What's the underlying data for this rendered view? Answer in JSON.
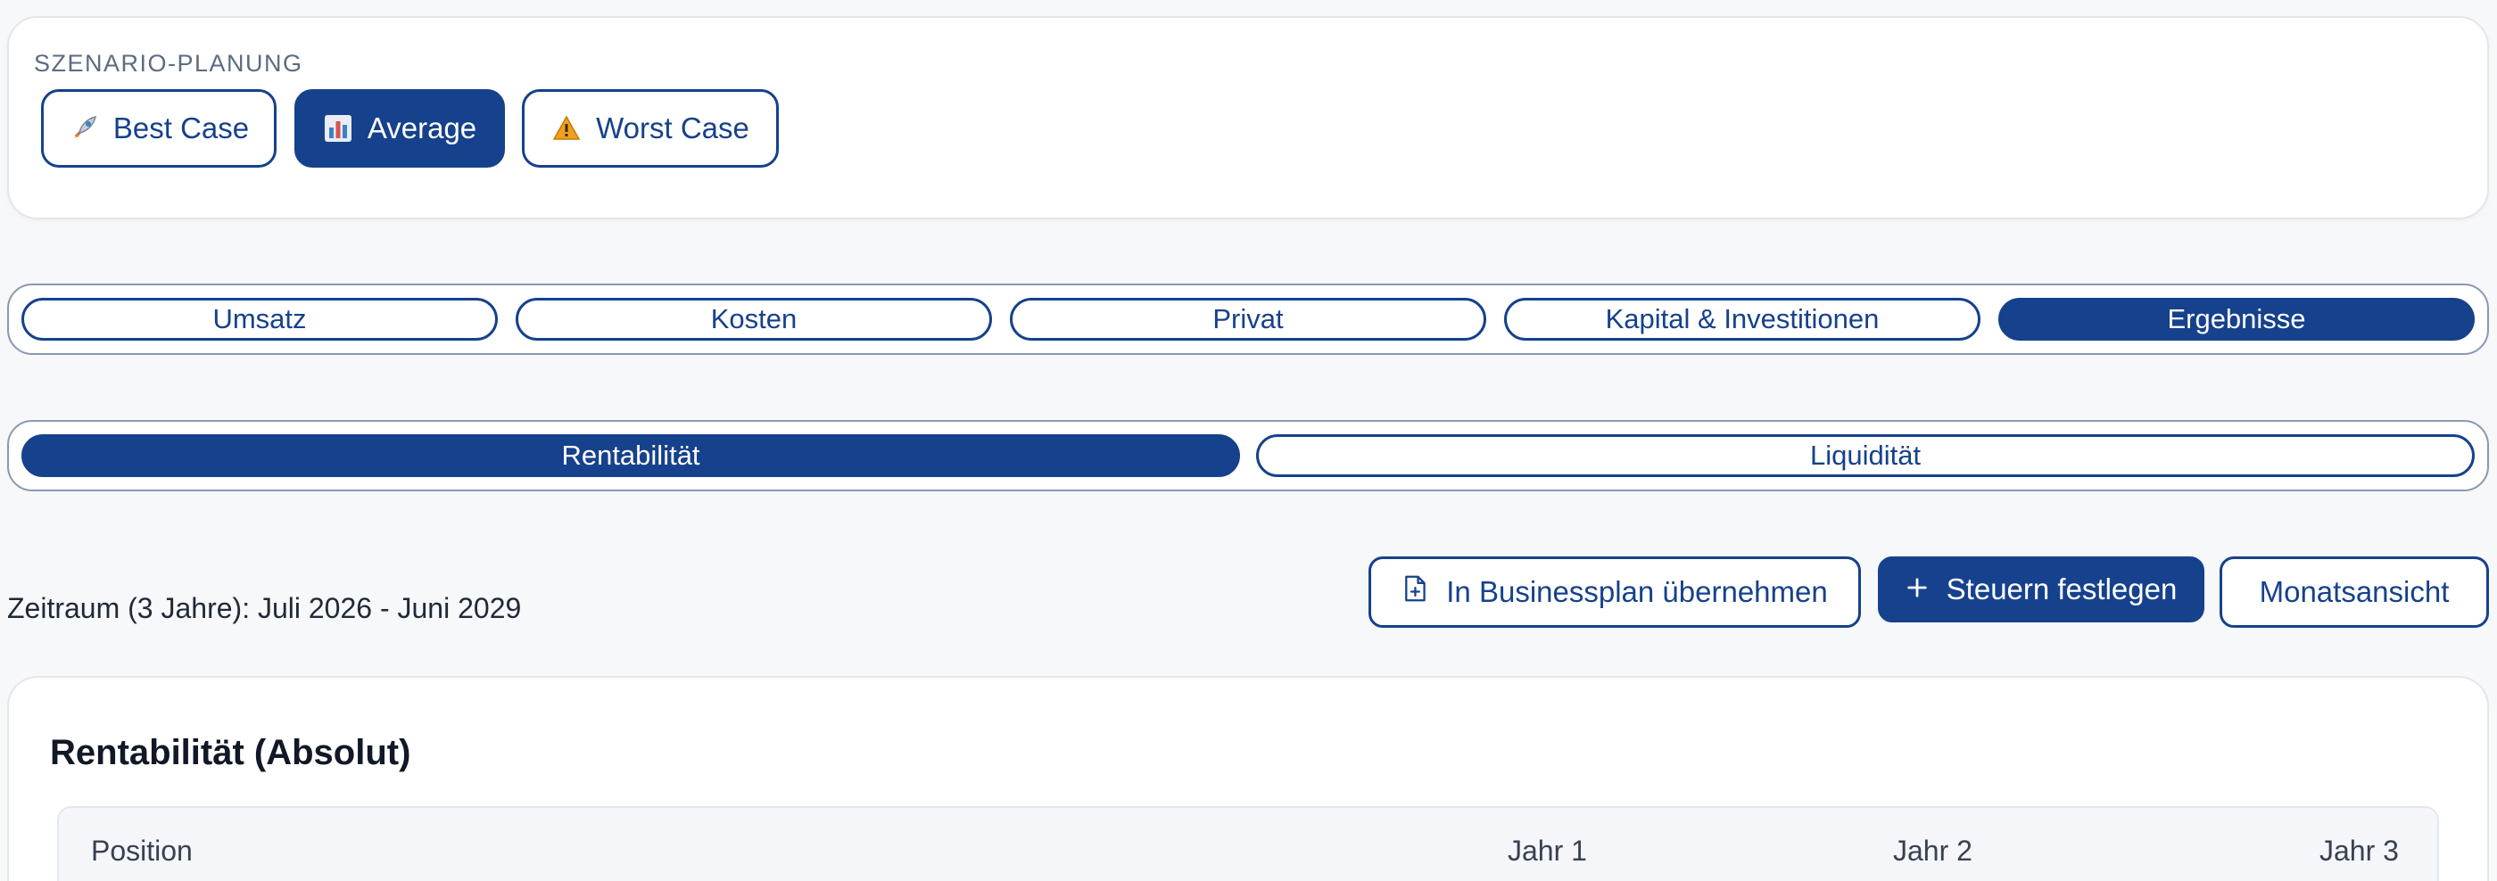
{
  "scenario": {
    "label": "SZENARIO-PLANUNG",
    "options": [
      {
        "label": "Best Case",
        "icon": "rocket-icon",
        "active": false
      },
      {
        "label": "Average",
        "icon": "bar-chart-icon",
        "active": true
      },
      {
        "label": "Worst Case",
        "icon": "warning-icon",
        "active": false
      }
    ]
  },
  "main_tabs": [
    {
      "label": "Umsatz",
      "active": false
    },
    {
      "label": "Kosten",
      "active": false
    },
    {
      "label": "Privat",
      "active": false
    },
    {
      "label": "Kapital & Investitionen",
      "active": false
    },
    {
      "label": "Ergebnisse",
      "active": true
    }
  ],
  "sub_tabs": [
    {
      "label": "Rentabilität",
      "active": true
    },
    {
      "label": "Liquidität",
      "active": false
    }
  ],
  "toolbar": {
    "period": "Zeitraum (3 Jahre): Juli 2026 - Juni 2029",
    "businessplan_label": "In Businessplan übernehmen",
    "taxes_label": "Steuern festlegen",
    "monthly_label": "Monatsansicht"
  },
  "result": {
    "title": "Rentabilität (Absolut)",
    "columns": [
      "Position",
      "Jahr 1",
      "Jahr 2",
      "Jahr 3"
    ]
  },
  "colors": {
    "accent": "#16418c",
    "background": "#f7f8fa"
  }
}
